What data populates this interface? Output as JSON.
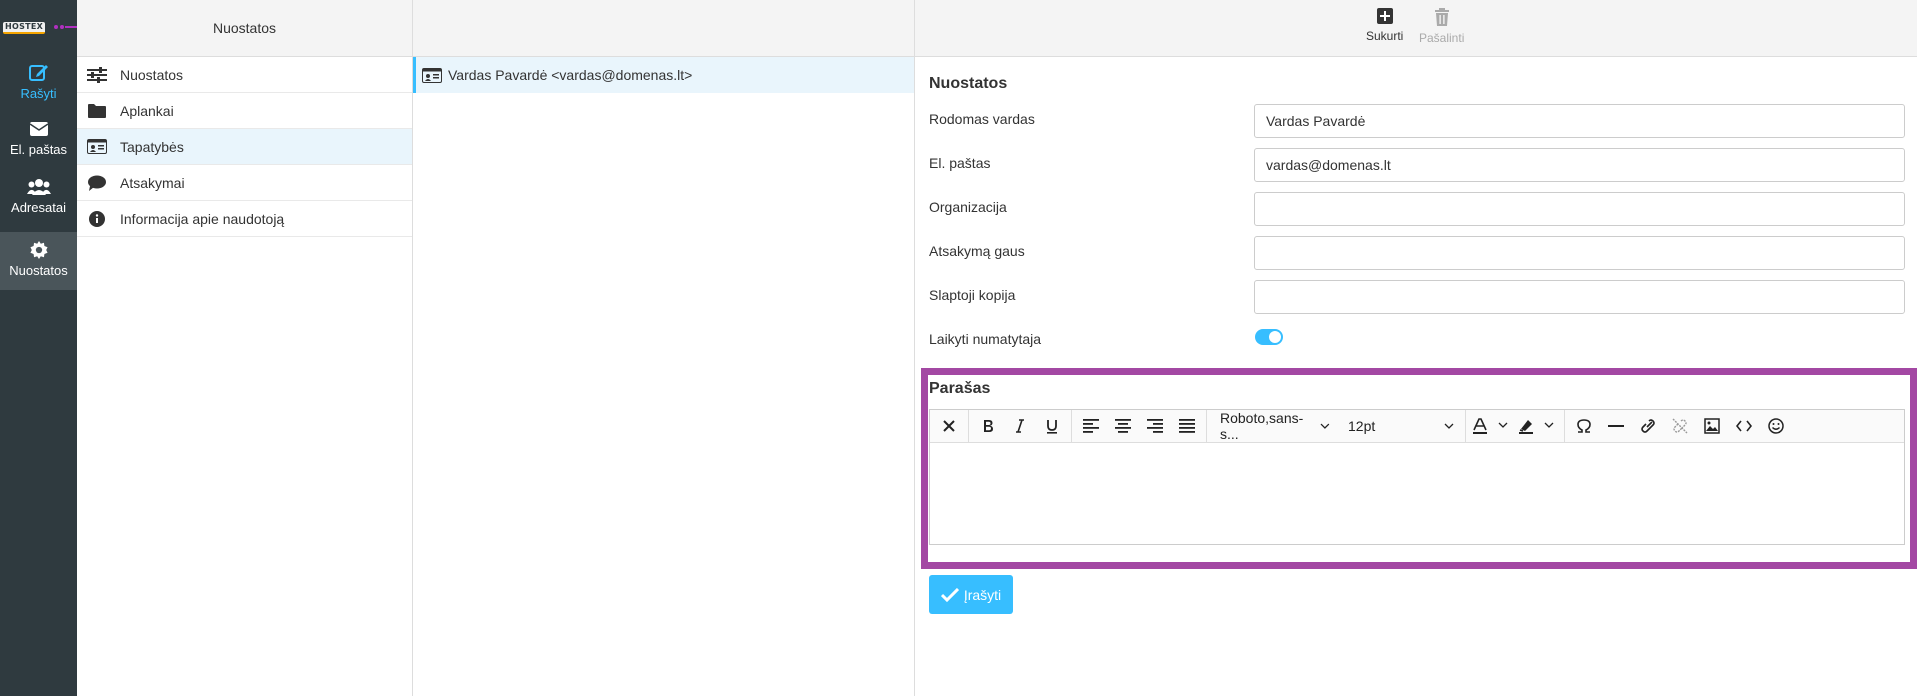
{
  "brand": {
    "logo_text": "HOSTEX"
  },
  "nav": {
    "items": [
      {
        "label": "Rašyti",
        "icon": "compose-icon"
      },
      {
        "label": "El. paštas",
        "icon": "envelope-icon"
      },
      {
        "label": "Adresatai",
        "icon": "users-icon"
      },
      {
        "label": "Nuostatos",
        "icon": "gear-icon"
      }
    ]
  },
  "settings_panel": {
    "header": "Nuostatos",
    "items": [
      {
        "label": "Nuostatos",
        "icon": "sliders-icon"
      },
      {
        "label": "Aplankai",
        "icon": "folder-icon"
      },
      {
        "label": "Tapatybės",
        "icon": "id-card-icon"
      },
      {
        "label": "Atsakymai",
        "icon": "comment-icon"
      },
      {
        "label": "Informacija apie naudotoją",
        "icon": "info-icon"
      }
    ]
  },
  "identities": {
    "items": [
      {
        "label": "Vardas Pavardė <vardas@domenas.lt>",
        "icon": "id-card-icon"
      }
    ]
  },
  "toolbar": {
    "create_label": "Sukurti",
    "delete_label": "Pašalinti"
  },
  "form": {
    "title": "Nuostatos",
    "fields": [
      {
        "label": "Rodomas vardas",
        "value": "Vardas Pavardė"
      },
      {
        "label": "El. paštas",
        "value": "vardas@domenas.lt"
      },
      {
        "label": "Organizacija",
        "value": ""
      },
      {
        "label": "Atsakymą gaus",
        "value": ""
      },
      {
        "label": "Slaptoji kopija",
        "value": ""
      }
    ],
    "default_label": "Laikyti numatytaja",
    "default_on": true
  },
  "signature": {
    "title": "Parašas",
    "font_family": "Roboto,sans-s...",
    "font_size": "12pt",
    "content": ""
  },
  "save_label": "Įrašyti",
  "colors": {
    "accent": "#37beff",
    "highlight_border": "#a348a3",
    "nav_bg": "#2f3a3f"
  }
}
